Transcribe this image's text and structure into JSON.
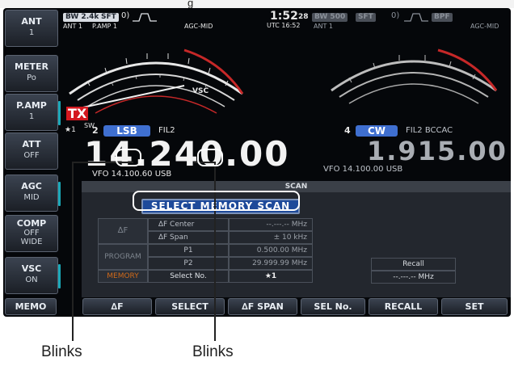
{
  "cut_heading": "g",
  "side_keys": [
    {
      "label": "ANT",
      "sub": "1"
    },
    {
      "label": "METER",
      "sub": "Po"
    },
    {
      "label": "P.AMP",
      "sub": "1"
    },
    {
      "label": "ATT",
      "sub": "OFF"
    },
    {
      "label": "AGC",
      "sub": "MID"
    },
    {
      "label": "COMP",
      "sub": "OFF\nWIDE"
    },
    {
      "label": "VSC",
      "sub": "ON"
    }
  ],
  "main": {
    "bw_chip": "BW 2.4k",
    "sft_chip": "SFT",
    "sft_val": "0)",
    "ant_label": "ANT 1",
    "pamp_label": "P.AMP 1",
    "agc_label": "AGC-MID",
    "time": "1:52",
    "time_sec": "28",
    "utc": "UTC 16:52",
    "tx_badge": "TX",
    "sw_label": "SW",
    "vsc_label": "VSC",
    "mode_num": "2",
    "mode": "LSB",
    "fil": "FIL2",
    "star": "★1",
    "freq": "14.240.00",
    "vfo_line": "VFO  14.100.60  USB"
  },
  "sub": {
    "bw_chip": "BW 500",
    "sft_chip": "SFT",
    "sft_val": "0)",
    "bpf_chip": "BPF",
    "ant_label": "ANT 1",
    "agc_label": "AGC-MID",
    "mode_num": "4",
    "mode": "CW",
    "fil": "FIL2  BCCAC",
    "freq": "1.915.00",
    "vfo_line": "VFO  14.100.00  USB"
  },
  "scan": {
    "title": "SCAN",
    "select_label": "SELECT MEMORY SCAN",
    "groups": [
      "∆F",
      "PROGRAM",
      "MEMORY"
    ],
    "rows": [
      {
        "param": "∆F  Center",
        "value": "--.---.-- MHz"
      },
      {
        "param": "∆F  Span",
        "value": "±  10  kHz"
      },
      {
        "param": "P1",
        "value": "0.500.00  MHz"
      },
      {
        "param": "P2",
        "value": "29.999.99  MHz"
      },
      {
        "param": "Select No.",
        "value": "★1"
      }
    ],
    "recall_title": "Recall",
    "recall_value": "--.---.--  MHz"
  },
  "bottom_keys": [
    "MEMO",
    "∆F",
    "SELECT",
    "∆F SPAN",
    "SEL No.",
    "RECALL",
    "SET"
  ],
  "annotations": [
    "Blinks",
    "Blinks"
  ],
  "colors": {
    "accent_blue": "#1e4a9a",
    "tx_red": "#d4181f",
    "meter_red": "#c62828",
    "memory_orange": "#d06a1a"
  }
}
